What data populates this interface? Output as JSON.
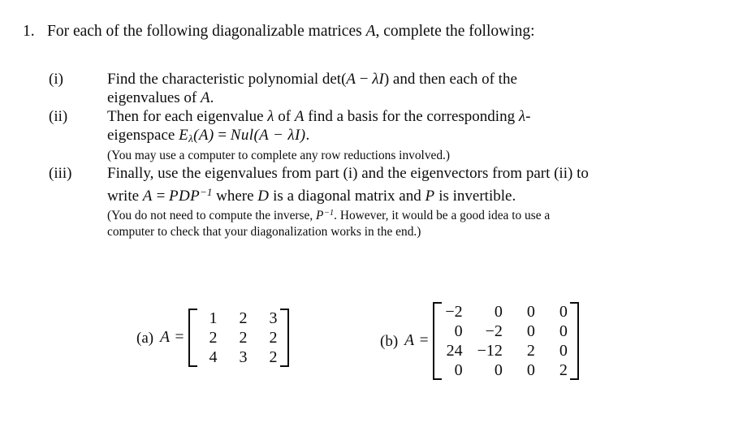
{
  "document": {
    "problem": {
      "number": "1.",
      "text": "For each of the following diagonalizable matrices A, complete the following:"
    },
    "subitems": [
      {
        "label": "(i)",
        "lines": [
          "Find the characteristic polynomial det(A − λI) and then each of the",
          "eigenvalues of A."
        ],
        "notes": []
      },
      {
        "label": "(ii)",
        "lines": [
          "Then for each eigenvalue λ of A find a basis for the corresponding λ-",
          "eigenspace Eλ(A) = Nul(A − λI)."
        ],
        "notes": [
          "(You may use a computer to complete any row reductions involved.)"
        ]
      },
      {
        "label": "(iii)",
        "lines": [
          "Finally, use the eigenvalues from part (i) and the eigenvectors from part (ii) to",
          "write A = PDP−1 where D is a diagonal matrix and P is invertible."
        ],
        "notes": [
          "(You do not need to compute the inverse, P−1. However, it would be a good idea to use a",
          "computer to check that your diagonalization works in the end.)"
        ]
      }
    ],
    "matrices": [
      {
        "label": "(a)",
        "equation": "A =",
        "rows": [
          [
            "1",
            "2",
            "3"
          ],
          [
            "2",
            "2",
            "2"
          ],
          [
            "4",
            "3",
            "2"
          ]
        ]
      },
      {
        "label": "(b)",
        "equation": "A =",
        "rows": [
          [
            "−2",
            "0",
            "0",
            "0"
          ],
          [
            "0",
            "−2",
            "0",
            "0"
          ],
          [
            "24",
            "−12",
            "2",
            "0"
          ],
          [
            "0",
            "0",
            "0",
            "2"
          ]
        ]
      }
    ],
    "colors": {
      "background": "#ffffff",
      "text": "#0d0d0d"
    }
  }
}
